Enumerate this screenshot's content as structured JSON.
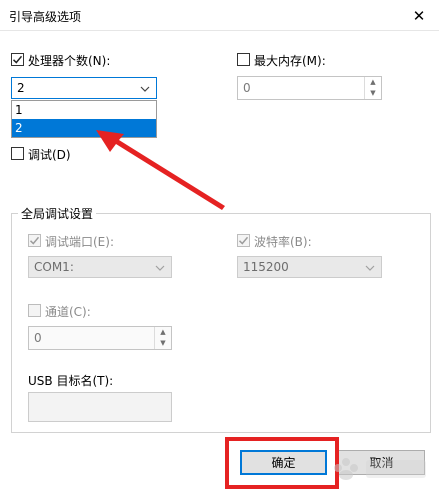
{
  "window": {
    "title": "引导高级选项",
    "close_glyph": "✕"
  },
  "processors": {
    "checkbox_label": "处理器个数(N):",
    "checked": true,
    "selected_value": "2",
    "options": [
      "1",
      "2"
    ]
  },
  "max_memory": {
    "checkbox_label": "最大内存(M):",
    "checked": false,
    "value": "0"
  },
  "debug": {
    "checkbox_label": "调试(D)",
    "checked": false
  },
  "global_debug": {
    "group_title": "全局调试设置",
    "debug_port_label": "调试端口(E):",
    "debug_port_value": "COM1:",
    "baud_rate_label": "波特率(B):",
    "baud_rate_value": "115200",
    "channel_label": "通道(C):",
    "channel_value": "0",
    "usb_target_label": "USB 目标名(T):",
    "usb_target_value": ""
  },
  "buttons": {
    "ok_label": "确定",
    "cancel_label": "取消"
  },
  "colors": {
    "selection": "#0078d7",
    "annotation_red": "#e52222"
  }
}
